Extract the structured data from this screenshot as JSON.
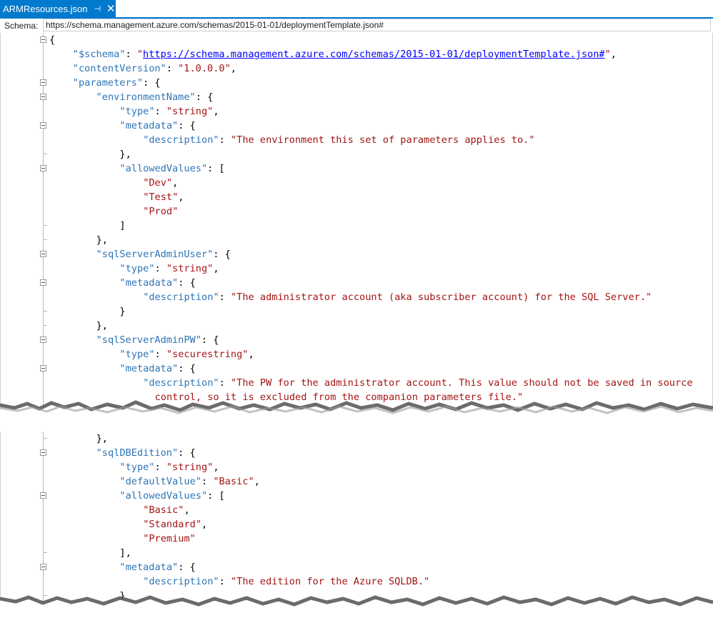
{
  "tab": {
    "title": "ARMResources.json",
    "pin_glyph": "⊣",
    "close_glyph": "✕"
  },
  "schema_bar": {
    "label": "Schema:",
    "value": "https://schema.management.azure.com/schemas/2015-01-01/deploymentTemplate.json#"
  },
  "colors": {
    "accent": "#007acc",
    "json_key": "#2e75b6",
    "json_string": "#a31515",
    "json_url": "#0000ff",
    "punctuation": "#000000"
  },
  "panels": [
    {
      "lines": [
        {
          "indent": 0,
          "fold": true,
          "tokens": [
            {
              "t": "p",
              "v": "{"
            }
          ]
        },
        {
          "indent": 1,
          "tokens": [
            {
              "t": "k",
              "v": "\"$schema\""
            },
            {
              "t": "p",
              "v": ": "
            },
            {
              "t": "s",
              "v": "\""
            },
            {
              "t": "u",
              "v": "https://schema.management.azure.com/schemas/2015-01-01/deploymentTemplate.json#"
            },
            {
              "t": "s",
              "v": "\""
            },
            {
              "t": "p",
              "v": ","
            }
          ]
        },
        {
          "indent": 1,
          "tokens": [
            {
              "t": "k",
              "v": "\"contentVersion\""
            },
            {
              "t": "p",
              "v": ": "
            },
            {
              "t": "s",
              "v": "\"1.0.0.0\""
            },
            {
              "t": "p",
              "v": ","
            }
          ]
        },
        {
          "indent": 1,
          "fold": true,
          "tokens": [
            {
              "t": "k",
              "v": "\"parameters\""
            },
            {
              "t": "p",
              "v": ": {"
            }
          ]
        },
        {
          "indent": 2,
          "fold": true,
          "tokens": [
            {
              "t": "k",
              "v": "\"environmentName\""
            },
            {
              "t": "p",
              "v": ": {"
            }
          ]
        },
        {
          "indent": 3,
          "tokens": [
            {
              "t": "k",
              "v": "\"type\""
            },
            {
              "t": "p",
              "v": ": "
            },
            {
              "t": "s",
              "v": "\"string\""
            },
            {
              "t": "p",
              "v": ","
            }
          ]
        },
        {
          "indent": 3,
          "fold": true,
          "tokens": [
            {
              "t": "k",
              "v": "\"metadata\""
            },
            {
              "t": "p",
              "v": ": {"
            }
          ]
        },
        {
          "indent": 4,
          "tokens": [
            {
              "t": "k",
              "v": "\"description\""
            },
            {
              "t": "p",
              "v": ": "
            },
            {
              "t": "s",
              "v": "\"The environment this set of parameters applies to.\""
            }
          ]
        },
        {
          "indent": 3,
          "foldend": true,
          "tokens": [
            {
              "t": "p",
              "v": "},"
            }
          ]
        },
        {
          "indent": 3,
          "fold": true,
          "tokens": [
            {
              "t": "k",
              "v": "\"allowedValues\""
            },
            {
              "t": "p",
              "v": ": ["
            }
          ]
        },
        {
          "indent": 4,
          "tokens": [
            {
              "t": "s",
              "v": "\"Dev\""
            },
            {
              "t": "p",
              "v": ","
            }
          ]
        },
        {
          "indent": 4,
          "tokens": [
            {
              "t": "s",
              "v": "\"Test\""
            },
            {
              "t": "p",
              "v": ","
            }
          ]
        },
        {
          "indent": 4,
          "tokens": [
            {
              "t": "s",
              "v": "\"Prod\""
            }
          ]
        },
        {
          "indent": 3,
          "foldend": true,
          "tokens": [
            {
              "t": "p",
              "v": "]"
            }
          ]
        },
        {
          "indent": 2,
          "foldend": true,
          "tokens": [
            {
              "t": "p",
              "v": "},"
            }
          ]
        },
        {
          "indent": 2,
          "fold": true,
          "tokens": [
            {
              "t": "k",
              "v": "\"sqlServerAdminUser\""
            },
            {
              "t": "p",
              "v": ": {"
            }
          ]
        },
        {
          "indent": 3,
          "tokens": [
            {
              "t": "k",
              "v": "\"type\""
            },
            {
              "t": "p",
              "v": ": "
            },
            {
              "t": "s",
              "v": "\"string\""
            },
            {
              "t": "p",
              "v": ","
            }
          ]
        },
        {
          "indent": 3,
          "fold": true,
          "tokens": [
            {
              "t": "k",
              "v": "\"metadata\""
            },
            {
              "t": "p",
              "v": ": {"
            }
          ]
        },
        {
          "indent": 4,
          "tokens": [
            {
              "t": "k",
              "v": "\"description\""
            },
            {
              "t": "p",
              "v": ": "
            },
            {
              "t": "s",
              "v": "\"The administrator account (aka subscriber account) for the SQL Server.\""
            }
          ]
        },
        {
          "indent": 3,
          "foldend": true,
          "tokens": [
            {
              "t": "p",
              "v": "}"
            }
          ]
        },
        {
          "indent": 2,
          "foldend": true,
          "tokens": [
            {
              "t": "p",
              "v": "},"
            }
          ]
        },
        {
          "indent": 2,
          "fold": true,
          "tokens": [
            {
              "t": "k",
              "v": "\"sqlServerAdminPW\""
            },
            {
              "t": "p",
              "v": ": {"
            }
          ]
        },
        {
          "indent": 3,
          "tokens": [
            {
              "t": "k",
              "v": "\"type\""
            },
            {
              "t": "p",
              "v": ": "
            },
            {
              "t": "s",
              "v": "\"securestring\""
            },
            {
              "t": "p",
              "v": ","
            }
          ]
        },
        {
          "indent": 3,
          "fold": true,
          "tokens": [
            {
              "t": "k",
              "v": "\"metadata\""
            },
            {
              "t": "p",
              "v": ": {"
            }
          ]
        },
        {
          "indent": 4,
          "tokens": [
            {
              "t": "k",
              "v": "\"description\""
            },
            {
              "t": "p",
              "v": ": "
            },
            {
              "t": "s",
              "v": "\"The PW for the administrator account. This value should not be saved in source"
            }
          ]
        },
        {
          "indent": 4,
          "wrap": true,
          "tokens": [
            {
              "t": "s",
              "v": "control, so it is excluded from the companion parameters file.\""
            }
          ]
        }
      ]
    },
    {
      "lines": [
        {
          "indent": 2,
          "foldend": true,
          "tokens": [
            {
              "t": "p",
              "v": "},"
            }
          ]
        },
        {
          "indent": 2,
          "fold": true,
          "tokens": [
            {
              "t": "k",
              "v": "\"sqlDBEdition\""
            },
            {
              "t": "p",
              "v": ": {"
            }
          ]
        },
        {
          "indent": 3,
          "tokens": [
            {
              "t": "k",
              "v": "\"type\""
            },
            {
              "t": "p",
              "v": ": "
            },
            {
              "t": "s",
              "v": "\"string\""
            },
            {
              "t": "p",
              "v": ","
            }
          ]
        },
        {
          "indent": 3,
          "tokens": [
            {
              "t": "k",
              "v": "\"defaultValue\""
            },
            {
              "t": "p",
              "v": ": "
            },
            {
              "t": "s",
              "v": "\"Basic\""
            },
            {
              "t": "p",
              "v": ","
            }
          ]
        },
        {
          "indent": 3,
          "fold": true,
          "tokens": [
            {
              "t": "k",
              "v": "\"allowedValues\""
            },
            {
              "t": "p",
              "v": ": ["
            }
          ]
        },
        {
          "indent": 4,
          "tokens": [
            {
              "t": "s",
              "v": "\"Basic\""
            },
            {
              "t": "p",
              "v": ","
            }
          ]
        },
        {
          "indent": 4,
          "tokens": [
            {
              "t": "s",
              "v": "\"Standard\""
            },
            {
              "t": "p",
              "v": ","
            }
          ]
        },
        {
          "indent": 4,
          "tokens": [
            {
              "t": "s",
              "v": "\"Premium\""
            }
          ]
        },
        {
          "indent": 3,
          "foldend": true,
          "tokens": [
            {
              "t": "p",
              "v": "],"
            }
          ]
        },
        {
          "indent": 3,
          "fold": true,
          "tokens": [
            {
              "t": "k",
              "v": "\"metadata\""
            },
            {
              "t": "p",
              "v": ": {"
            }
          ]
        },
        {
          "indent": 4,
          "tokens": [
            {
              "t": "k",
              "v": "\"description\""
            },
            {
              "t": "p",
              "v": ": "
            },
            {
              "t": "s",
              "v": "\"The edition for the Azure SQLDB.\""
            }
          ]
        },
        {
          "indent": 3,
          "foldend": true,
          "tokens": [
            {
              "t": "p",
              "v": "}"
            }
          ]
        }
      ]
    }
  ]
}
